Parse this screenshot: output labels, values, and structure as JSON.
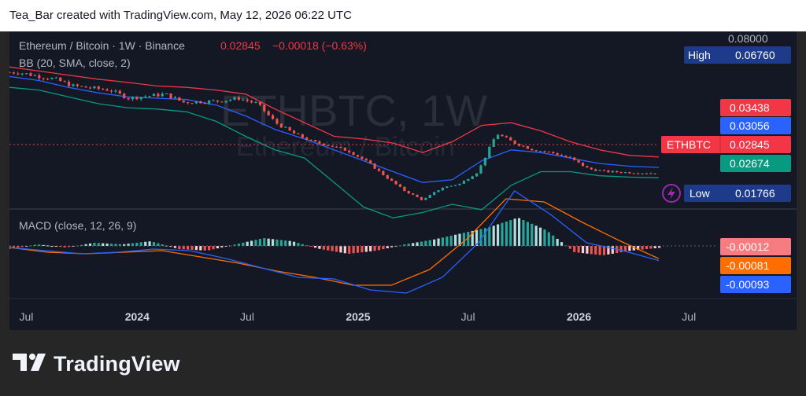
{
  "header": {
    "caption": "Tea_Bar created with TradingView.com, May 12, 2026 06:22 UTC"
  },
  "legend": {
    "symbol": "Ethereum / Bitcoin · 1W · Binance",
    "price": "0.02845",
    "change": "−0.00018 (−0.63%)",
    "bb": "BB (20, SMA, close, 2)",
    "macd": "MACD (close, 12, 26, 9)"
  },
  "watermark": {
    "ticker": "ETHBTC, 1W",
    "name": "Ethereum / Bitcoin"
  },
  "price_labels": {
    "top_scale": "0.08000",
    "high_label": "High",
    "high_value": "0.06760",
    "bb_upper": "0.03438",
    "bb_basis": "0.03056",
    "symbol_tag": "ETHBTC",
    "last": "0.02845",
    "bb_lower": "0.02674",
    "low_label": "Low",
    "low_value": "0.01766"
  },
  "macd_labels": {
    "histogram": "-0.00012",
    "signal": "-0.00081",
    "macd": "-0.00093"
  },
  "footer": {
    "brand": "TradingView"
  },
  "colors": {
    "background": "#141824",
    "bull": "#26a69a",
    "bear": "#ef5350",
    "bb_upper": "#f23645",
    "bb_basis": "#2962ff",
    "bb_lower": "#089981",
    "macd_line": "#2962ff",
    "signal_line": "#ff6d00",
    "label_blue": "#2962ff",
    "label_red": "#f23645",
    "label_green": "#089981",
    "label_orange": "#ff6d00",
    "label_navy": "#1e3a8a"
  },
  "chart_data": {
    "type": "candlestick",
    "x_ticks": [
      "Jul",
      "2024",
      "Jul",
      "2025",
      "Jul",
      "2026",
      "Jul"
    ],
    "price_ylim": [
      0.017,
      0.069
    ],
    "price_path": [
      [
        "2023-06",
        0.0655
      ],
      [
        "2023-08",
        0.063
      ],
      [
        "2023-09",
        0.0605
      ],
      [
        "2023-11",
        0.059
      ],
      [
        "2023-12",
        0.056
      ],
      [
        "2024-02",
        0.0575
      ],
      [
        "2024-03",
        0.0545
      ],
      [
        "2024-05",
        0.055
      ],
      [
        "2024-06",
        0.056
      ],
      [
        "2024-07",
        0.054
      ],
      [
        "2024-08",
        0.047
      ],
      [
        "2024-09",
        0.043
      ],
      [
        "2024-10",
        0.04
      ],
      [
        "2024-11",
        0.0385
      ],
      [
        "2024-12",
        0.0365
      ],
      [
        "2025-01",
        0.0325
      ],
      [
        "2025-02",
        0.027
      ],
      [
        "2025-03",
        0.022
      ],
      [
        "2025-04",
        0.0185
      ],
      [
        "2025-05",
        0.023
      ],
      [
        "2025-06",
        0.0245
      ],
      [
        "2025-07",
        0.029
      ],
      [
        "2025-08",
        0.043
      ],
      [
        "2025-09",
        0.0395
      ],
      [
        "2025-10",
        0.037
      ],
      [
        "2025-11",
        0.036
      ],
      [
        "2025-12",
        0.034
      ],
      [
        "2026-01",
        0.03
      ],
      [
        "2026-02",
        0.029
      ],
      [
        "2026-04",
        0.0285
      ],
      [
        "2026-05",
        0.02845
      ]
    ],
    "bollinger": {
      "upper": [
        0.0675,
        0.066,
        0.0645,
        0.063,
        0.0618,
        0.0605,
        0.06,
        0.059,
        0.0575,
        0.052,
        0.047,
        0.042,
        0.041,
        0.0395,
        0.036,
        0.04,
        0.046,
        0.047,
        0.044,
        0.04,
        0.037,
        0.035,
        0.03438
      ],
      "basis": [
        0.064,
        0.0625,
        0.06,
        0.058,
        0.0565,
        0.056,
        0.0555,
        0.0535,
        0.0495,
        0.0445,
        0.041,
        0.037,
        0.033,
        0.029,
        0.025,
        0.026,
        0.033,
        0.037,
        0.036,
        0.034,
        0.032,
        0.031,
        0.03056
      ],
      "lower": [
        0.06,
        0.059,
        0.0565,
        0.054,
        0.0525,
        0.052,
        0.051,
        0.0475,
        0.042,
        0.037,
        0.034,
        0.025,
        0.016,
        0.012,
        0.014,
        0.017,
        0.015,
        0.024,
        0.029,
        0.029,
        0.0275,
        0.027,
        0.02674
      ]
    },
    "macd": {
      "hist": [
        -0.0002,
        0.0001,
        -0.0001,
        0.0002,
        0.0001,
        0.0003,
        -0.0002,
        -0.0003,
        0.0001,
        0.0005,
        0.0003,
        -0.0002,
        -0.0005,
        -0.0003,
        0.0001,
        0.0004,
        0.0008,
        0.0012,
        0.0018,
        0.001,
        -0.0004,
        -0.0006,
        -0.0003,
        -0.00012
      ],
      "macd_line": [
        -0.0001,
        -0.0003,
        -0.0005,
        -0.0004,
        -0.0002,
        -0.0003,
        -0.0008,
        -0.0014,
        -0.002,
        -0.0021,
        -0.0028,
        -0.003,
        -0.002,
        0.0002,
        0.0035,
        0.002,
        0.0002,
        -0.0003,
        -0.00093
      ],
      "signal_line": [
        -0.0001,
        -0.0004,
        -0.0005,
        -0.0004,
        -0.0003,
        -0.0007,
        -0.0011,
        -0.0016,
        -0.002,
        -0.0025,
        -0.0025,
        -0.0015,
        0.0005,
        0.003,
        0.0028,
        0.0015,
        0.0003,
        -0.00081
      ]
    }
  }
}
